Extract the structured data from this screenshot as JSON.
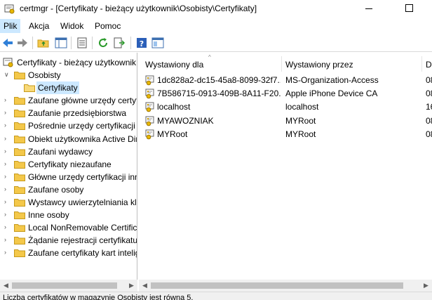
{
  "window": {
    "title": "certmgr - [Certyfikaty - bieżący użytkownik\\Osobisty\\Certyfikaty]"
  },
  "menu": {
    "items": [
      "Plik",
      "Akcja",
      "Widok",
      "Pomoc"
    ]
  },
  "toolbar": {
    "buttons": [
      "back-arrow-icon",
      "forward-arrow-icon",
      "up-folder-icon",
      "show-tree-icon",
      "properties-icon",
      "refresh-icon",
      "export-list-icon",
      "help-icon",
      "console-tree-icon"
    ]
  },
  "tree": {
    "root": "Certyfikaty - bieżący użytkownik",
    "items": [
      "Osobisty",
      "Certyfikaty",
      "Zaufane główne urzędy certyfikacji",
      "Zaufanie przedsiębiorstwa",
      "Pośrednie urzędy certyfikacji",
      "Obiekt użytkownika Active Directory",
      "Zaufani wydawcy",
      "Certyfikaty niezaufane",
      "Główne urzędy certyfikacji innych firm",
      "Zaufane osoby",
      "Wystawcy uwierzytelniania klienta",
      "Inne osoby",
      "Local NonRemovable Certificates",
      "Żądanie rejestracji certyfikatu",
      "Zaufane certyfikaty kart inteligentnych"
    ]
  },
  "list": {
    "columns": [
      "Wystawiony dla",
      "Wystawiony przez",
      "D"
    ],
    "rows": [
      {
        "issued_to": "1dc828a2-dc15-45a8-8099-32f7...",
        "issued_by": "MS-Organization-Access",
        "date": "08"
      },
      {
        "issued_to": "7B586715-0913-409B-8A11-F20...",
        "issued_by": "Apple iPhone Device CA",
        "date": "08"
      },
      {
        "issued_to": "localhost",
        "issued_by": "localhost",
        "date": "16"
      },
      {
        "issued_to": "MYAWOZNIAK",
        "issued_by": "MYRoot",
        "date": "08"
      },
      {
        "issued_to": "MYRoot",
        "issued_by": "MYRoot",
        "date": "08"
      }
    ]
  },
  "status": {
    "text": "Liczba certyfikatów w magazynie Osobisty jest równa 5."
  },
  "colors": {
    "selection": "#cce8ff",
    "folder": "#f4c84a",
    "status_bar": "#f0f0f0"
  }
}
